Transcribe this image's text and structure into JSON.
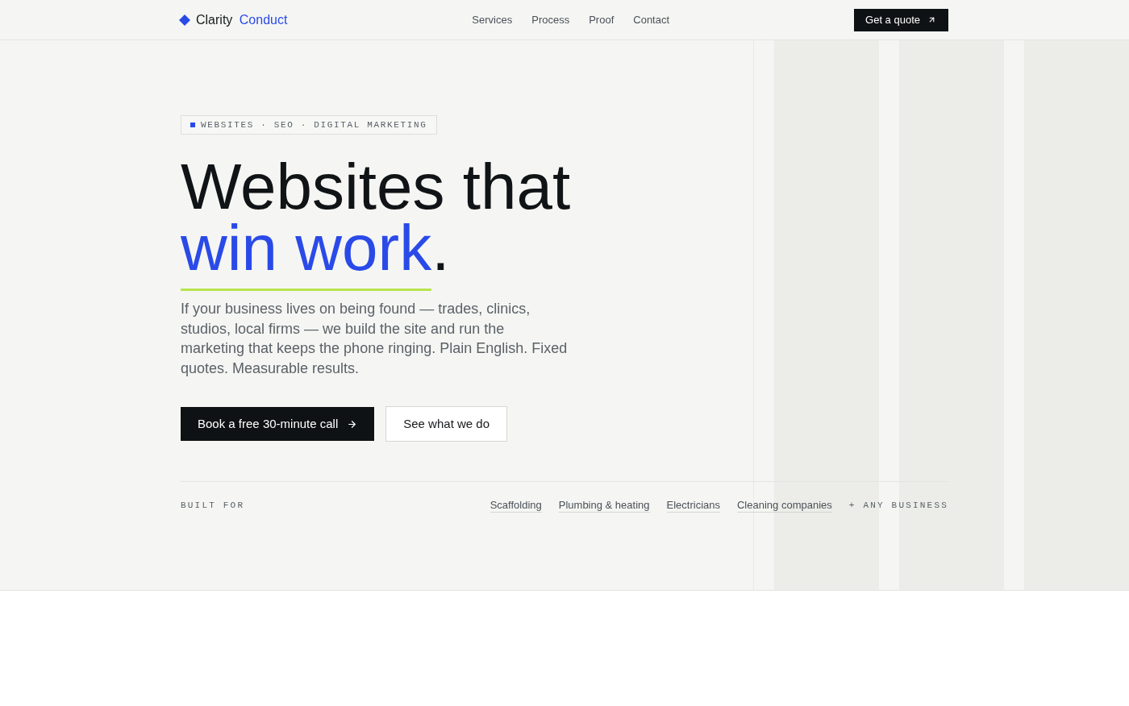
{
  "nav": {
    "brand": {
      "name": "Clarity",
      "accent": "Conduct"
    },
    "links": [
      "Services",
      "Process",
      "Proof",
      "Contact"
    ],
    "cta": "Get a quote"
  },
  "hero": {
    "eyebrow": "WEBSITES · SEO · DIGITAL MARKETING",
    "heading": {
      "line_1": "Websites that",
      "highlight": "win work",
      "end": "."
    },
    "intro": "If your business lives on being found — trades, clinics, studios, local firms — we build the site and run the marketing that keeps the phone ringing. Plain English. Fixed quotes. Measurable results.",
    "buttons": [
      {
        "label": "Book a free 30-minute call",
        "kind": "primary"
      },
      {
        "label": "See what we do",
        "kind": "secondary"
      }
    ]
  },
  "built_for": {
    "label": "BUILT FOR",
    "industries": [
      "Scaffolding",
      "Plumbing & heating",
      "Electricians",
      "Cleaning companies"
    ],
    "more": "+ ANY BUSINESS"
  }
}
